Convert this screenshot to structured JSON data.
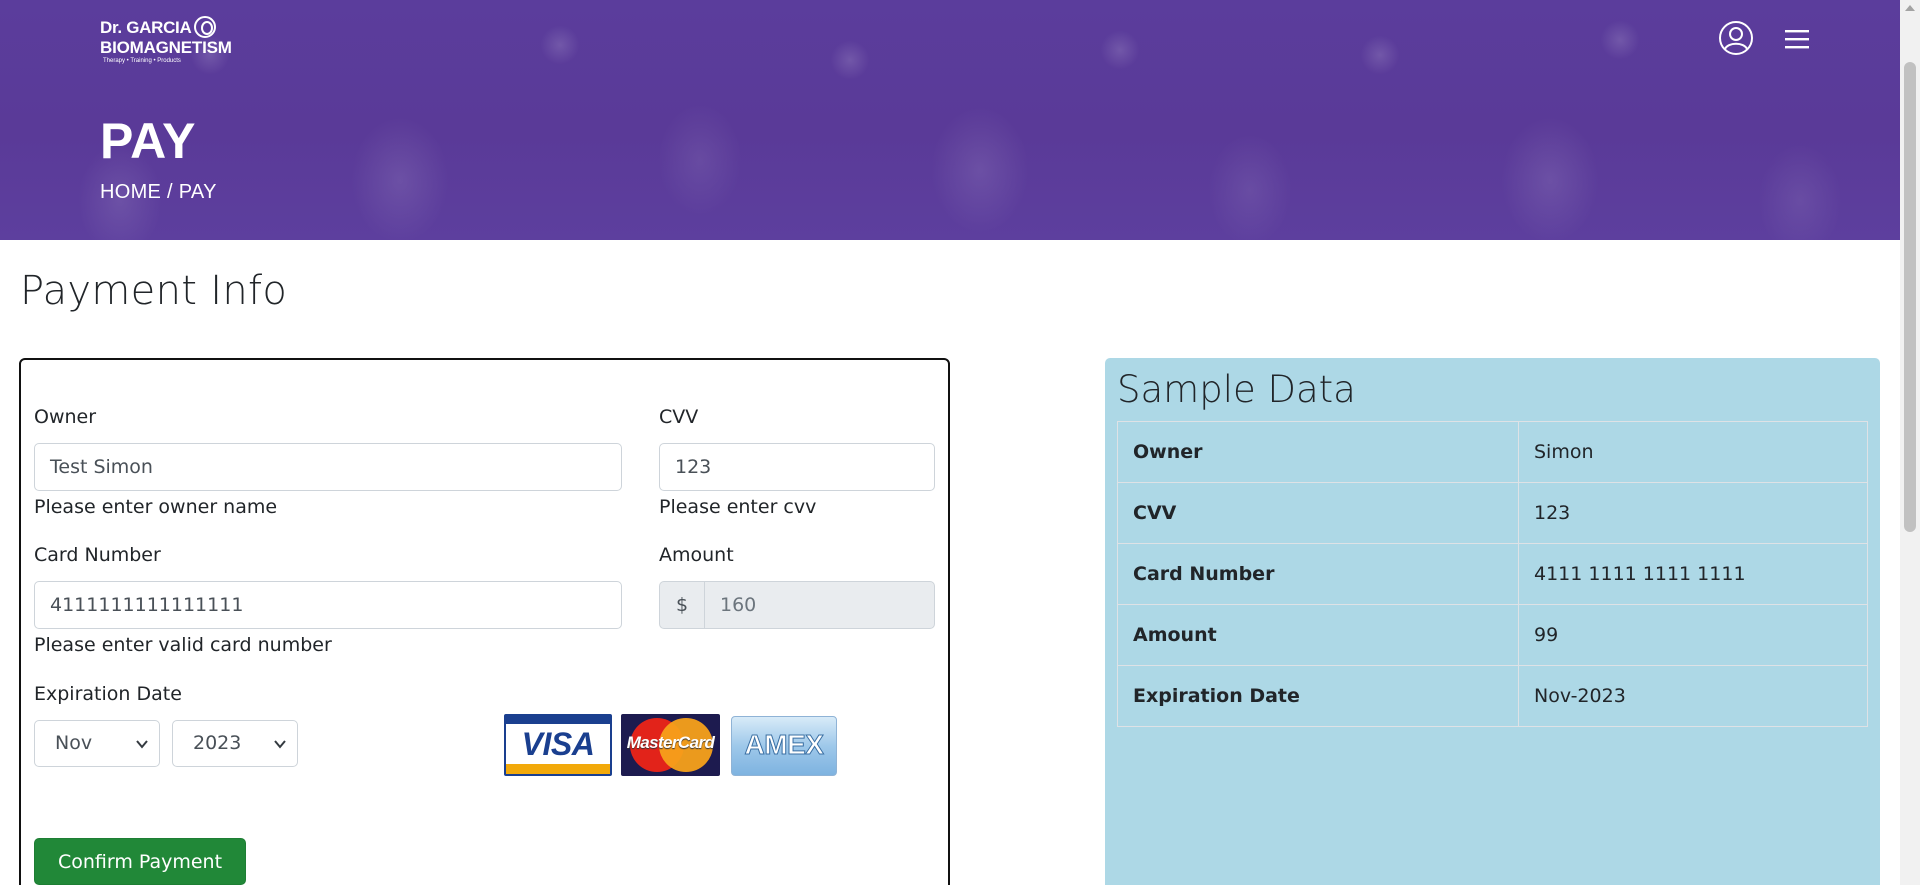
{
  "header": {
    "logo": {
      "line1": "Dr. GARCIA",
      "line2": "BIOMAGNETISM",
      "line3": "Therapy • Training • Products"
    },
    "title": "PAY",
    "breadcrumb": {
      "home": "HOME",
      "separator": " / ",
      "current": "PAY"
    },
    "icons": {
      "account": "user-circle-icon",
      "menu": "hamburger-menu-icon"
    }
  },
  "section_title": "Payment Info",
  "form": {
    "owner": {
      "label": "Owner",
      "value": "Test  Simon",
      "help": "Please enter owner name"
    },
    "cvv": {
      "label": "CVV",
      "value": "123",
      "help": "Please enter cvv"
    },
    "card_number": {
      "label": "Card Number",
      "value": "4111111111111111",
      "help": "Please enter valid card number"
    },
    "amount": {
      "label": "Amount",
      "prefix": "$",
      "value": "160"
    },
    "expiration": {
      "label": "Expiration Date",
      "month": "Nov",
      "year": "2023"
    },
    "card_logos": {
      "visa": "VISA",
      "mastercard": "MasterCard",
      "amex": "AMEX"
    },
    "confirm_label": "Confirm Payment"
  },
  "sample": {
    "title": "Sample Data",
    "rows": [
      {
        "key": "Owner",
        "value": "Simon"
      },
      {
        "key": "CVV",
        "value": "123"
      },
      {
        "key": "Card Number",
        "value": "4111 1111 1111 1111"
      },
      {
        "key": "Amount",
        "value": "99"
      },
      {
        "key": "Expiration Date",
        "value": "Nov-2023"
      }
    ]
  },
  "colors": {
    "hero": "#5b3d9c",
    "sample_bg": "#add8e6",
    "confirm_button": "#218838"
  }
}
